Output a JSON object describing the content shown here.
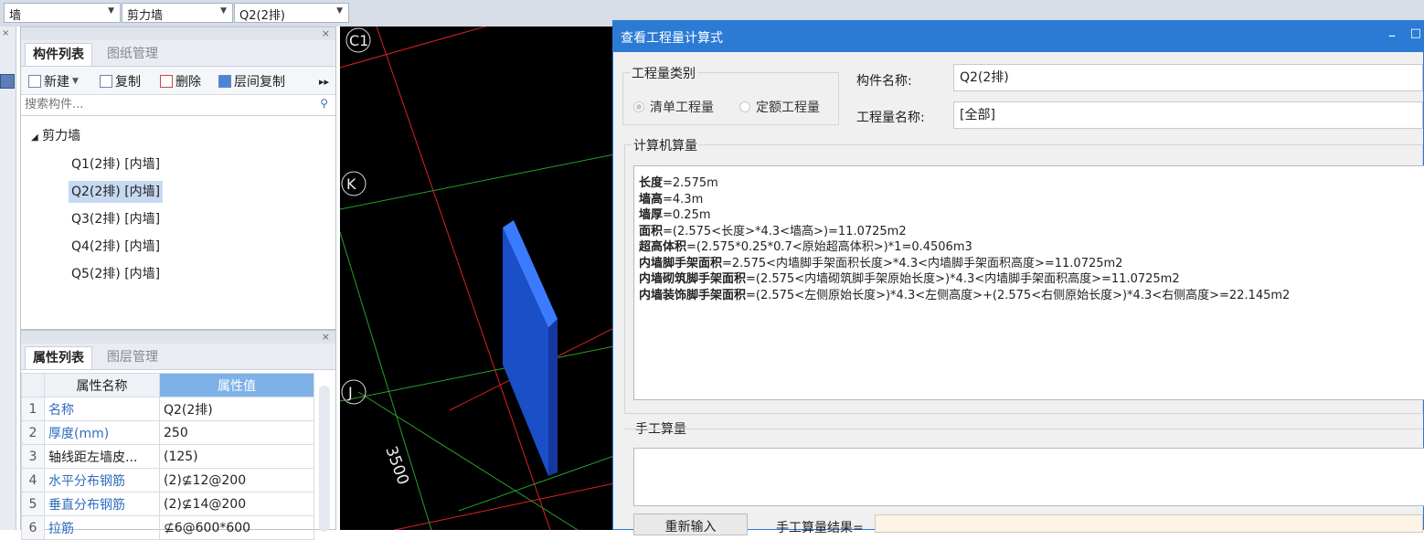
{
  "topbar": {
    "combo1": "墙",
    "combo2": "剪力墙",
    "combo3": "Q2(2排)"
  },
  "component_panel": {
    "tabs": [
      "构件列表",
      "图纸管理"
    ],
    "toolbar": {
      "new": "新建",
      "copy": "复制",
      "delete": "删除",
      "floor_copy": "层间复制"
    },
    "search_placeholder": "搜索构件...",
    "tree": {
      "root": "剪力墙",
      "items": [
        "Q1(2排) [内墙]",
        "Q2(2排) [内墙]",
        "Q3(2排) [内墙]",
        "Q4(2排) [内墙]",
        "Q5(2排) [内墙]"
      ],
      "selected_index": 1
    }
  },
  "property_panel": {
    "tabs": [
      "属性列表",
      "图层管理"
    ],
    "headers": {
      "name": "属性名称",
      "value": "属性值"
    },
    "rows": [
      {
        "num": "1",
        "name": "名称",
        "value": "Q2(2排)"
      },
      {
        "num": "2",
        "name": "厚度(mm)",
        "value": "250"
      },
      {
        "num": "3",
        "name": "轴线距左墙皮...",
        "value": "(125)"
      },
      {
        "num": "4",
        "name": "水平分布钢筋",
        "value": "(2)⊈12@200"
      },
      {
        "num": "5",
        "name": "垂直分布钢筋",
        "value": "(2)⊈14@200"
      },
      {
        "num": "6",
        "name": "拉筋",
        "value": "⊈6@600*600"
      }
    ]
  },
  "cad": {
    "labels": {
      "c1": "C1",
      "k": "K",
      "j": "J",
      "dim": "3500"
    },
    "colors": {
      "background": "#000000",
      "red_axis": "#e02020",
      "green_axis": "#2aa02a",
      "wall": "#1a5fe0"
    }
  },
  "dialog": {
    "title": "查看工程量计算式",
    "category_group": "工程量类别",
    "radio_bill": "清单工程量",
    "radio_quota": "定额工程量",
    "component_name_label": "构件名称:",
    "component_name_value": "Q2(2排)",
    "quantity_name_label": "工程量名称:",
    "quantity_name_value": "[全部]",
    "computer_calc_group": "计算机算量",
    "calc_lines": [
      {
        "key": "长度",
        "expr": "=2.575m"
      },
      {
        "key": "墙高",
        "expr": "=4.3m"
      },
      {
        "key": "墙厚",
        "expr": "=0.25m"
      },
      {
        "key": "面积",
        "expr": "=(2.575<长度>*4.3<墙高>)=11.0725m2"
      },
      {
        "key": "超高体积",
        "expr": "=(2.575*0.25*0.7<原始超高体积>)*1=0.4506m3"
      },
      {
        "key": "内墙脚手架面积",
        "expr": "=2.575<内墙脚手架面积长度>*4.3<内墙脚手架面积高度>=11.0725m2"
      },
      {
        "key": "内墙砌筑脚手架面积",
        "expr": "=(2.575<内墙砌筑脚手架原始长度>)*4.3<内墙脚手架面积高度>=11.0725m2"
      },
      {
        "key": "内墙装饰脚手架面积",
        "expr": "=(2.575<左侧原始长度>)*4.3<左侧高度>+(2.575<右侧原始长度>)*4.3<右侧高度>=22.145m2"
      }
    ],
    "manual_calc_group": "手工算量",
    "reinput_button": "重新输入",
    "manual_result_label": "手工算量结果="
  }
}
